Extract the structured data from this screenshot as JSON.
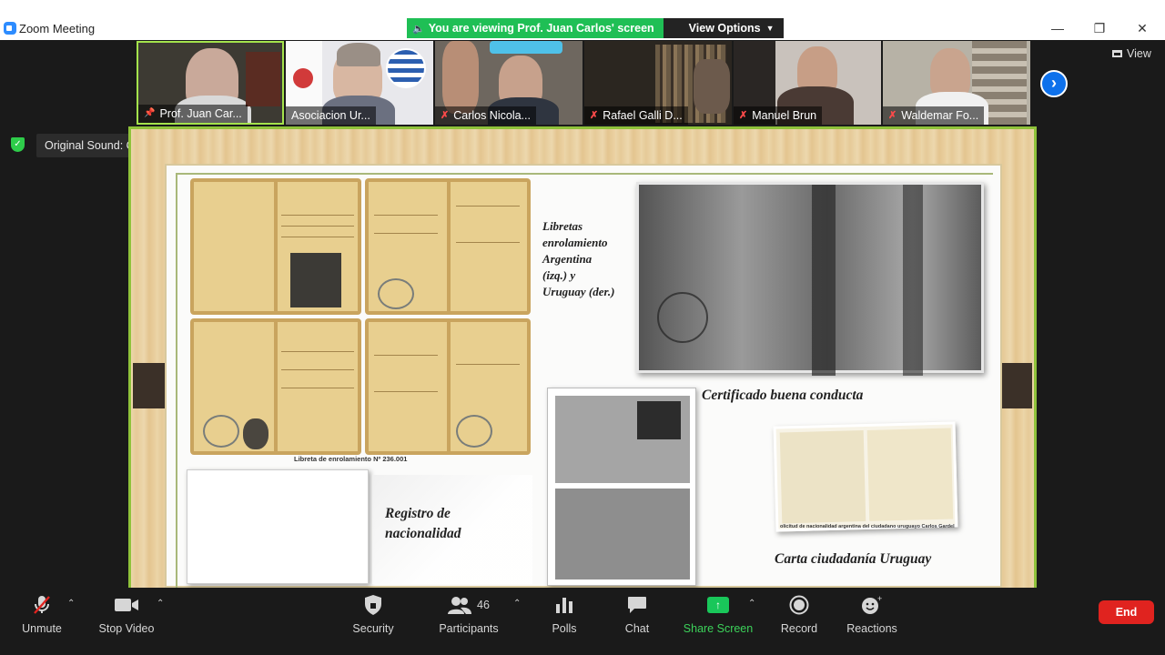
{
  "window": {
    "title": "Zoom Meeting",
    "controls": {
      "minimize": "—",
      "restore": "❐",
      "close": "✕"
    }
  },
  "banner": {
    "viewing_text": "You are viewing Prof. Juan Carlos' screen",
    "view_options": "View Options"
  },
  "participants_strip": [
    {
      "name": "Prof. Juan Car...",
      "muted": false,
      "active": true
    },
    {
      "name": "Asociacion Ur...",
      "muted": false,
      "active": false
    },
    {
      "name": "Carlos Nicola...",
      "muted": true,
      "active": false
    },
    {
      "name": "Rafael Galli D...",
      "muted": true,
      "active": false
    },
    {
      "name": "Manuel Brun",
      "muted": true,
      "active": false
    },
    {
      "name": "Waldemar Fo...",
      "muted": true,
      "active": false
    }
  ],
  "view_label": "View",
  "original_sound": "Original Sound: Off",
  "slide": {
    "libretas_label": "Libretas enrolamiento Argentina (izq.) y Uruguay (der.)",
    "libretas_lines": [
      "Libretas",
      "enrolamiento",
      "Argentina",
      "(izq.) y",
      "Uruguay (der.)"
    ],
    "certificado_label": "Certificado buena conducta",
    "libreta_caption": "Libreta de enrolamiento Nº 236.001",
    "registro_lines": [
      "Registro de",
      "nacionalidad"
    ],
    "carta_label": "Carta ciudadanía Uruguay",
    "carta_caption": "olicitud de nacionalidad argentina del ciudadano uruguayo Carlos Gardel"
  },
  "toolbar": {
    "unmute": "Unmute",
    "stop_video": "Stop Video",
    "security": "Security",
    "participants": "Participants",
    "participants_count": "46",
    "polls": "Polls",
    "chat": "Chat",
    "share_screen": "Share Screen",
    "record": "Record",
    "reactions": "Reactions",
    "end": "End"
  },
  "colors": {
    "share_green": "#1fbf55",
    "active_border": "#a4e34c",
    "end_red": "#e0231f",
    "zoom_blue": "#0e71eb"
  }
}
